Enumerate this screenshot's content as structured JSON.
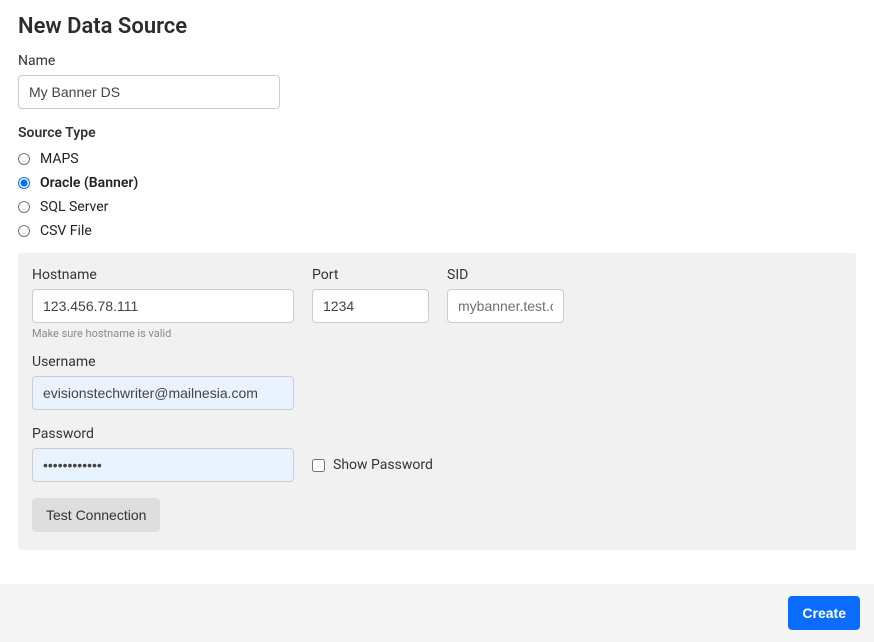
{
  "page_title": "New Data Source",
  "name": {
    "label": "Name",
    "value": "My Banner DS"
  },
  "source_type": {
    "label": "Source Type",
    "options": [
      {
        "id": "maps",
        "label": "MAPS",
        "selected": false
      },
      {
        "id": "oracle",
        "label": "Oracle (Banner)",
        "selected": true
      },
      {
        "id": "sqlserver",
        "label": "SQL Server",
        "selected": false
      },
      {
        "id": "csv",
        "label": "CSV File",
        "selected": false
      }
    ]
  },
  "connection": {
    "hostname": {
      "label": "Hostname",
      "value": "123.456.78.111",
      "hint": "Make sure hostname is valid"
    },
    "port": {
      "label": "Port",
      "value": "1234"
    },
    "sid": {
      "label": "SID",
      "value": "mybanner.test.con"
    },
    "username": {
      "label": "Username",
      "value": "evisionstechwriter@mailnesia.com"
    },
    "password": {
      "label": "Password",
      "value": "••••••••••••"
    },
    "show_password": {
      "label": "Show Password",
      "checked": false
    },
    "test_button": "Test Connection"
  },
  "footer": {
    "create_button": "Create"
  }
}
